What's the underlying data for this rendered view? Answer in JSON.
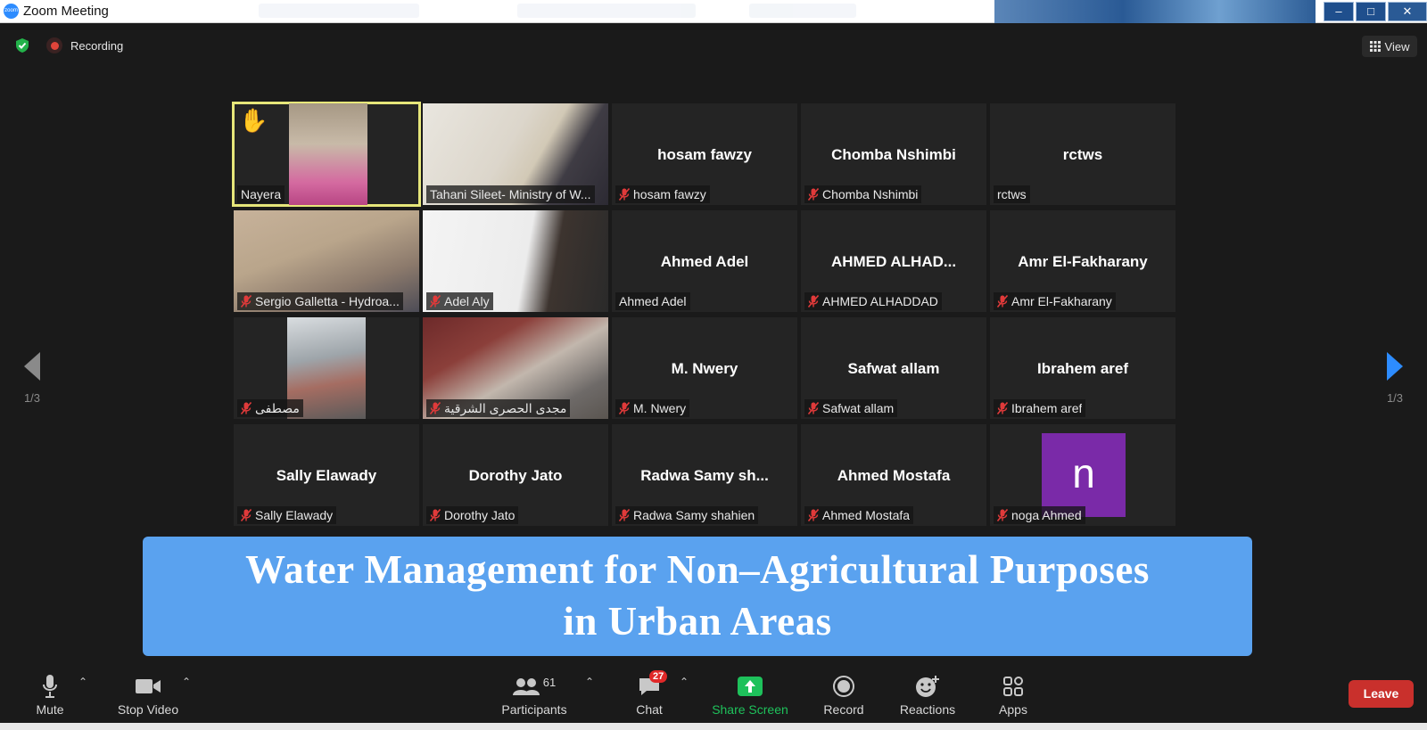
{
  "window": {
    "title": "Zoom Meeting"
  },
  "top": {
    "recording_label": "Recording",
    "view_label": "View"
  },
  "nav": {
    "left_page": "1/3",
    "right_page": "1/3"
  },
  "participants": [
    {
      "name": "Nayera",
      "display": "",
      "muted": false,
      "video": "nayera",
      "hand_raised": true,
      "active_speaker": true
    },
    {
      "name": "Tahani Sileet- Ministry of W...",
      "display": "",
      "muted": false,
      "video": "tahani"
    },
    {
      "name": "hosam fawzy",
      "display": "hosam fawzy",
      "muted": true
    },
    {
      "name": "Chomba Nshimbi",
      "display": "Chomba Nshimbi",
      "muted": true
    },
    {
      "name": "rctws",
      "display": "rctws",
      "muted": false
    },
    {
      "name": "Sergio Galletta - Hydroa...",
      "display": "",
      "muted": true,
      "video": "sergio"
    },
    {
      "name": "Adel Aly",
      "display": "",
      "muted": true,
      "video": "adel"
    },
    {
      "name": "Ahmed Adel",
      "display": "Ahmed Adel",
      "muted": false
    },
    {
      "name": "AHMED ALHADDAD",
      "display": "AHMED  ALHAD...",
      "muted": true
    },
    {
      "name": "Amr El-Fakharany",
      "display": "Amr El-Fakharany",
      "muted": true
    },
    {
      "name": "مصطفى",
      "display": "",
      "muted": true,
      "video": "mostafa"
    },
    {
      "name": "مجدى الحصرى الشرقية",
      "display": "",
      "muted": true,
      "video": "magdy"
    },
    {
      "name": "M. Nwery",
      "display": "M. Nwery",
      "muted": true
    },
    {
      "name": "Safwat allam",
      "display": "Safwat allam",
      "muted": true
    },
    {
      "name": "Ibrahem aref",
      "display": "Ibrahem aref",
      "muted": true
    },
    {
      "name": "Sally Elawady",
      "display": "Sally Elawady",
      "muted": true
    },
    {
      "name": "Dorothy Jato",
      "display": "Dorothy Jato",
      "muted": true
    },
    {
      "name": "Radwa Samy shahien",
      "display": "Radwa  Samy  sh...",
      "muted": true
    },
    {
      "name": "Ahmed Mostafa",
      "display": "Ahmed Mostafa",
      "muted": true
    },
    {
      "name": "noga Ahmed",
      "display": "",
      "muted": true,
      "avatar_letter": "n",
      "avatar_color": "#7a2aa8"
    }
  ],
  "banner": {
    "line1": "Water Management for Non–Agricultural Purposes",
    "line2": "in Urban Areas"
  },
  "toolbar": {
    "mute": "Mute",
    "stop_video": "Stop Video",
    "participants": "Participants",
    "participants_count": "61",
    "chat": "Chat",
    "chat_badge": "27",
    "share_screen": "Share Screen",
    "record": "Record",
    "reactions": "Reactions",
    "apps": "Apps",
    "leave": "Leave"
  },
  "colors": {
    "share_green": "#1ec15b",
    "leave_red": "#c9302c",
    "banner_blue": "#5aa2ef",
    "active_speaker": "#e6e67a",
    "nav_arrow_active": "#2d8cff"
  }
}
